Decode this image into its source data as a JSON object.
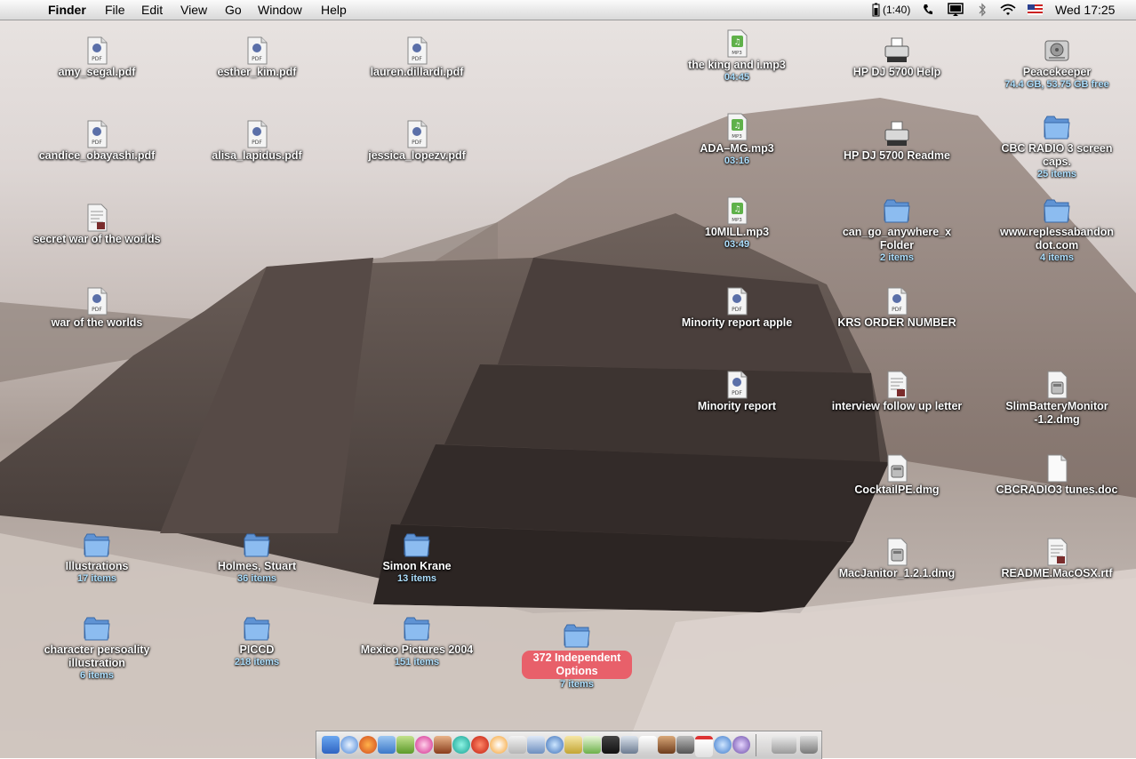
{
  "menubar": {
    "apple_glyph": "",
    "app_name": "Finder",
    "menus": [
      "File",
      "Edit",
      "View",
      "Go",
      "Window",
      "Help"
    ],
    "battery": "(1:40)",
    "clock": "Wed 17:25"
  },
  "desktop_icons": [
    {
      "name": "amy_segal.pdf",
      "sub": "",
      "kind": "pdf"
    },
    {
      "name": "esther_kim.pdf",
      "sub": "",
      "kind": "pdf"
    },
    {
      "name": "lauren.dillardi.pdf",
      "sub": "",
      "kind": "pdf"
    },
    {
      "name": "the king and i.mp3",
      "sub": "04:45",
      "kind": "mp3"
    },
    {
      "name": "HP DJ 5700 Help",
      "sub": "",
      "kind": "printer"
    },
    {
      "name": "Peacekeeper",
      "sub": "74.4 GB, 53.75 GB free",
      "kind": "disk"
    },
    {
      "name": "candice_obayashi.pdf",
      "sub": "",
      "kind": "pdf"
    },
    {
      "name": "alisa_lapidus.pdf",
      "sub": "",
      "kind": "pdf"
    },
    {
      "name": "jessica_lopezv.pdf",
      "sub": "",
      "kind": "pdf"
    },
    {
      "name": "ADA–MG.mp3",
      "sub": "03:16",
      "kind": "mp3"
    },
    {
      "name": "HP DJ 5700 Readme",
      "sub": "",
      "kind": "printer"
    },
    {
      "name": "CBC RADIO 3 screen caps.",
      "sub": "25 items",
      "kind": "folder"
    },
    {
      "name": "secret war of the worlds",
      "sub": "",
      "kind": "doc"
    },
    {
      "name": "10MILL.mp3",
      "sub": "03:49",
      "kind": "mp3"
    },
    {
      "name": "can_go_anywhere_x Folder",
      "sub": "2 items",
      "kind": "folder"
    },
    {
      "name": "www.replessabandon dot.com",
      "sub": "4 items",
      "kind": "folder"
    },
    {
      "name": "war of the worlds",
      "sub": "",
      "kind": "pdf"
    },
    {
      "name": "Minority report apple",
      "sub": "",
      "kind": "pdf"
    },
    {
      "name": "KRS ORDER NUMBER",
      "sub": "",
      "kind": "pdf"
    },
    {
      "name": "Minority report",
      "sub": "",
      "kind": "pdf"
    },
    {
      "name": "interview follow up letter",
      "sub": "",
      "kind": "doc"
    },
    {
      "name": "SlimBatteryMonitor -1.2.dmg",
      "sub": "",
      "kind": "dmg"
    },
    {
      "name": "CocktailPE.dmg",
      "sub": "",
      "kind": "dmg"
    },
    {
      "name": "CBCRADIO3 tunes.doc",
      "sub": "",
      "kind": "blank"
    },
    {
      "name": "MacJanitor_1.2.1.dmg",
      "sub": "",
      "kind": "dmg"
    },
    {
      "name": "README.MacOSX.rtf",
      "sub": "",
      "kind": "doc"
    },
    {
      "name": "Illustrations",
      "sub": "17 items",
      "kind": "folder"
    },
    {
      "name": "Holmes, Stuart",
      "sub": "36 items",
      "kind": "folder"
    },
    {
      "name": "Simon Krane",
      "sub": "13 items",
      "kind": "folder"
    },
    {
      "name": "character persoality illustration",
      "sub": "6 items",
      "kind": "folder"
    },
    {
      "name": "PICCD",
      "sub": "218 items",
      "kind": "folder"
    },
    {
      "name": "Mexico Pictures 2004",
      "sub": "151 items",
      "kind": "folder"
    },
    {
      "name": "372 Independent Options",
      "sub": "7 items",
      "kind": "folder",
      "selected": true
    }
  ],
  "dock_items": [
    "finder-icon",
    "safari-icon",
    "firefox-icon",
    "mail-icon",
    "ichat-icon",
    "flower-icon",
    "photoshop-icon",
    "sync-icon",
    "filezilla-icon",
    "vlc-icon",
    "text-icon",
    "preview-icon",
    "network-icon",
    "notes-icon",
    "itunes-icon",
    "grapher-icon",
    "system-icon",
    "textedit-icon",
    "photos-icon",
    "terminal-icon",
    "calendar-icon",
    "address-icon",
    "dvd-icon",
    "wifi-icon",
    "trash-icon"
  ],
  "colors": {
    "selection": "#e8606a",
    "folder": "#7fb2e8",
    "item_count": "#aee0ff"
  }
}
